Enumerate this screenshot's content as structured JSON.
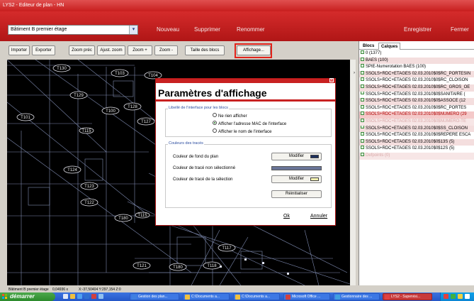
{
  "window": {
    "title": "LYS2 - Editeur de plan - HN"
  },
  "menubar": {
    "building_select": "Bâtiment B premier étage",
    "items": [
      "Nouveau",
      "Supprimer",
      "Renommer"
    ],
    "save_label": "Enregistrer",
    "close_label": "Fermer"
  },
  "toolbar": {
    "buttons": [
      "Importer",
      "Exporter",
      "Zoom préc",
      "Ajust. zoom",
      "Zoom +",
      "Zoom -",
      "Taille des blocs",
      "Affichage..."
    ]
  },
  "plan": {
    "node_labels": [
      "T130",
      "T103",
      "T104",
      "T129",
      "T100",
      "T128",
      "T127",
      "T101",
      "T115",
      "T124",
      "T123",
      "T122",
      "T180",
      "T115",
      "T117",
      "T121",
      "T180",
      "T118"
    ]
  },
  "right_panel": {
    "tabs": [
      "Blocs",
      "Calques"
    ],
    "active_tab": "Calques",
    "layers": [
      {
        "label": "0  (1377)",
        "state": "normal"
      },
      {
        "label": "BAES  (100)",
        "state": "hi"
      },
      {
        "label": "SPIE-Numerotation BAES  (100)",
        "state": "normal"
      },
      {
        "label": "SSOLS+RDC+ETAGES 02.03.2010$0$RC_PORTESIN",
        "state": "hi"
      },
      {
        "label": "SSOLS+RDC+ETAGES 02.03.2010$0$RC_CLOISON",
        "state": "normal"
      },
      {
        "label": "SSOLS+RDC+ETAGES 02.03.2010$0$RC_GROS_OE",
        "state": "hi"
      },
      {
        "label": "SSOLS+RDC+ETAGES 02.03.2010$0$SANITAIRE  (",
        "state": "normal"
      },
      {
        "label": "SSOLS+RDC+ETAGES 02.03.2010$0$ASSOCE  (12",
        "state": "hi"
      },
      {
        "label": "SSOLS+RDC+ETAGES 02.03.2010$0$RC_PORTES",
        "state": "normal"
      },
      {
        "label": "SSOLS+RDC+ETAGES 02.03.2010$0$NUMERO  (29",
        "state": "sel"
      },
      {
        "label": "SSOLS+RDC+ETAGES 02.03.2010$0$NUMERO-TE",
        "state": "dim"
      },
      {
        "label": "SSOLS+RDC+ETAGES 02.03.2010$0$SS_CLOISON",
        "state": "hi"
      },
      {
        "label": "SSOLS+RDC+ETAGES 02.03.2010$0$REPERE ESCA",
        "state": "normal"
      },
      {
        "label": "SSOLS+RDC+ETAGES 02.03.2010$0$13S  (5)",
        "state": "hi"
      },
      {
        "label": "SSOLS+RDC+ETAGES 02.03.2010$0$12S  (5)",
        "state": "normal"
      },
      {
        "label": "Defpoints  (0)",
        "state": "dim"
      }
    ]
  },
  "dialog": {
    "title": "Paramètres d'affichage",
    "label_group": "Libellé de l'interface pour les blocs",
    "radios": [
      {
        "label": "Ne rien afficher",
        "checked": false
      },
      {
        "label": "Afficher l'adresse MAC de l'interface",
        "checked": true
      },
      {
        "label": "Afficher le nom de l'interface",
        "checked": false
      }
    ],
    "color_group": "Couleurs des tracés",
    "rows": [
      {
        "label": "Couleur de fond du plan",
        "button": "Modifier",
        "color": "#1c2e5c"
      },
      {
        "label": "Couleur de tracé non sélectionné",
        "button": "",
        "color": "#6a7598"
      },
      {
        "label": "Couleur de tracé de la sélection",
        "button": "Modifier",
        "color": "#f2f0b0"
      }
    ],
    "reset_label": "Réinitialiser",
    "ok_label": "Ok",
    "cancel_label": "Annuler"
  },
  "status": {
    "floor": "Bâtiment B premier étage",
    "zoom": "0,04936 x",
    "coords": "X:-37,50404 Y:297,154 Z:0"
  },
  "taskbar": {
    "start_label": "démarrer",
    "tasks": [
      "Gestion des plan...",
      "C:\\Documents a...",
      "C:\\Documents a...",
      "Microsoft Office ...",
      "Gestionnaire des ...",
      "LYS2 - Supervisi..."
    ],
    "active_task": 5
  },
  "colors": {
    "brand": "#c81e1e",
    "highlight": "#e2231a"
  }
}
